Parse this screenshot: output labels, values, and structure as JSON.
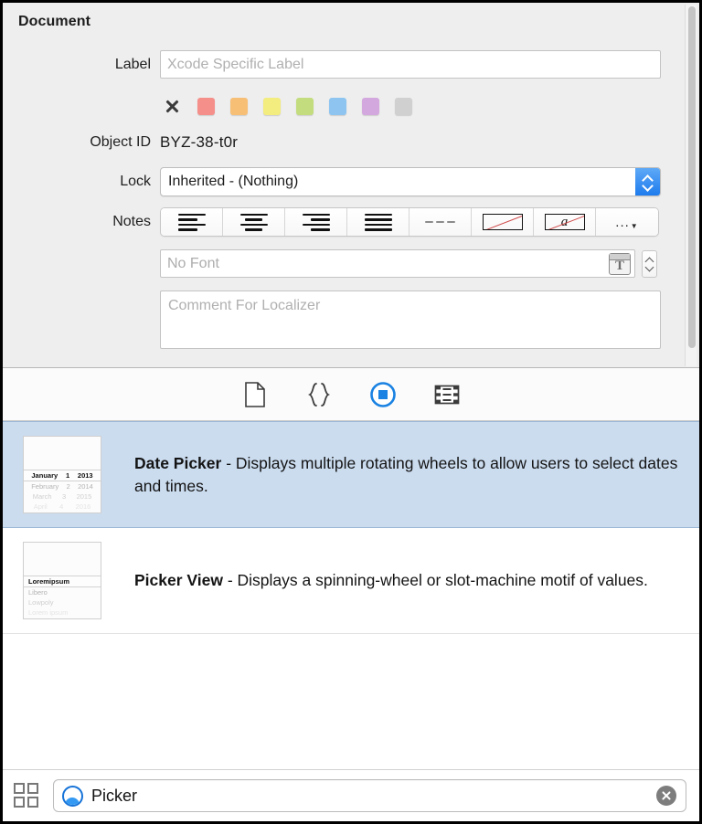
{
  "inspector": {
    "title": "Document",
    "label_row": {
      "label": "Label",
      "placeholder": "Xcode Specific Label",
      "value": ""
    },
    "colors": {
      "none_tooltip": "No Color",
      "swatches": [
        "#f58f8a",
        "#f7bf76",
        "#f3ec7e",
        "#c3dd7e",
        "#8ec5f0",
        "#d3a8de",
        "#d0d0d0"
      ]
    },
    "object_id_row": {
      "label": "Object ID",
      "value": "BYZ-38-t0r"
    },
    "lock_row": {
      "label": "Lock",
      "value": "Inherited - (Nothing)"
    },
    "notes_row": {
      "label": "Notes",
      "buttons": [
        {
          "name": "align-left",
          "glyph": "align-left-icon"
        },
        {
          "name": "align-center",
          "glyph": "align-center-icon"
        },
        {
          "name": "align-right",
          "glyph": "align-right-icon"
        },
        {
          "name": "align-justify",
          "glyph": "align-justify-icon"
        },
        {
          "name": "align-natural",
          "glyph": "dashes-icon"
        },
        {
          "name": "no-spelling",
          "glyph": "strikethrough-box-icon"
        },
        {
          "name": "no-grammar",
          "glyph": "strikethrough-a-icon",
          "letter": "a"
        },
        {
          "name": "more-options",
          "glyph": "ellipsis-icon",
          "label": "..."
        }
      ]
    },
    "font_row": {
      "placeholder": "No Font",
      "value": "",
      "panel_button": "T"
    },
    "comment_row": {
      "placeholder": "Comment For Localizer",
      "value": ""
    }
  },
  "library_tabs": [
    {
      "name": "file-template-library",
      "icon": "document-icon",
      "selected": false
    },
    {
      "name": "code-snippet-library",
      "icon": "braces-icon",
      "selected": false
    },
    {
      "name": "object-library",
      "icon": "circle-square-icon",
      "selected": true
    },
    {
      "name": "media-library",
      "icon": "filmstrip-icon",
      "selected": false
    }
  ],
  "library_items": [
    {
      "title": "Date Picker",
      "separator": " - ",
      "description": "Displays multiple rotating wheels to allow users to select dates and times.",
      "selected": true,
      "thumb": {
        "selected_row": [
          "January",
          "1",
          "2013"
        ],
        "faded_rows": [
          [
            "February",
            "2",
            "2014"
          ],
          [
            "March",
            "3",
            "2015"
          ],
          [
            "April",
            "4",
            "2016"
          ]
        ]
      }
    },
    {
      "title": "Picker View",
      "separator": " - ",
      "description": "Displays a spinning-wheel or slot-machine motif of values.",
      "selected": false,
      "thumb": {
        "selected_row": [
          "Loremipsum"
        ],
        "faded_rows": [
          [
            "Libero"
          ],
          [
            "Lowpoly"
          ],
          [
            "Lorem ipsum"
          ]
        ]
      }
    }
  ],
  "bottom_bar": {
    "view_toggle": "grid-view-icon",
    "search": {
      "value": "Picker",
      "placeholder": "",
      "filter_icon": "object-filter-icon",
      "clear": "clear-icon"
    }
  },
  "colors": {
    "selection": "#cbdcef",
    "accent": "#1673d8",
    "panel_bg": "#eeeeee"
  }
}
